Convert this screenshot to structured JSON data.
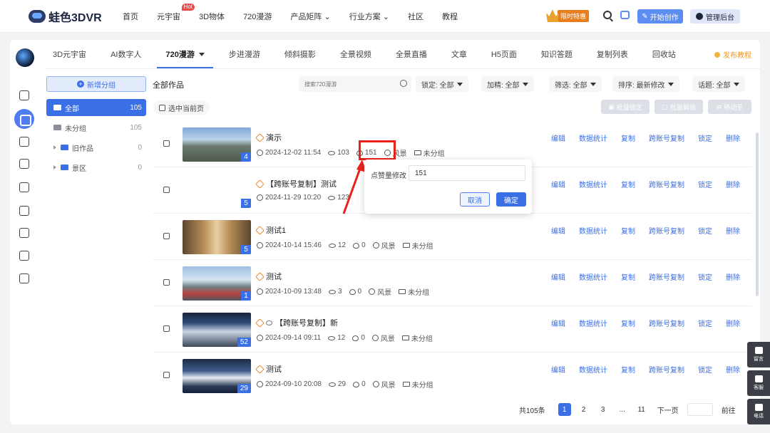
{
  "topnav": {
    "brand": "蛙色3DVR",
    "items": [
      "首页",
      "元宇宙",
      "3D物体",
      "720漫游",
      "产品矩阵",
      "行业方案",
      "社区",
      "教程"
    ],
    "hot_badge": "Hot",
    "promo": "限时特惠",
    "create_btn": "开始创作",
    "admin_btn": "管理后台"
  },
  "tabs": [
    "3D元宇宙",
    "AI数字人",
    "720漫游",
    "步进漫游",
    "倾斜摄影",
    "全景视频",
    "全景直播",
    "文章",
    "H5页面",
    "知识答题",
    "复制列表",
    "回收站"
  ],
  "publish_tutorial": "发布教程",
  "groups": {
    "add_btn": "新增分组",
    "items": [
      {
        "label": "全部",
        "count": "105"
      },
      {
        "label": "未分组",
        "count": "105"
      },
      {
        "label": "旧作品",
        "count": "0"
      },
      {
        "label": "景区",
        "count": "0"
      }
    ]
  },
  "content": {
    "heading": "全部作品",
    "search_placeholder": "搜索720漫游",
    "filters": {
      "lock": "锁定: 全部",
      "featured": "加精: 全部",
      "screen": "筛选: 全部",
      "sort": "排序: 最新修改",
      "topic": "话题: 全部"
    },
    "select_page": "选中当前页",
    "bulk": {
      "lock": "批量锁定",
      "unlock": "批量解锁",
      "move": "移动至"
    }
  },
  "actions": [
    "编辑",
    "数据统计",
    "复制",
    "跨账号复制",
    "锁定",
    "删除"
  ],
  "rows": [
    {
      "title": "演示",
      "date": "2024-12-02 11:54",
      "views": "103",
      "likes": "151",
      "tag": "风景",
      "group": "未分组",
      "scenes": "4"
    },
    {
      "title": "【跨账号复制】测试",
      "date": "2024-11-29 10:20",
      "views": "123",
      "likes": "",
      "tag": "",
      "group": "",
      "scenes": "5"
    },
    {
      "title": "测试1",
      "date": "2024-10-14 15:46",
      "views": "12",
      "likes": "0",
      "tag": "风景",
      "group": "未分组",
      "scenes": "5"
    },
    {
      "title": "测试",
      "date": "2024-10-09 13:48",
      "views": "3",
      "likes": "0",
      "tag": "风景",
      "group": "未分组",
      "scenes": "1"
    },
    {
      "title": "【跨账号复制】新",
      "date": "2024-09-14 09:11",
      "views": "12",
      "likes": "0",
      "tag": "风景",
      "group": "未分组",
      "scenes": "52"
    },
    {
      "title": "测试",
      "date": "2024-09-10 20:08",
      "views": "29",
      "likes": "0",
      "tag": "风景",
      "group": "未分组",
      "scenes": "29"
    }
  ],
  "popup": {
    "label": "点赞量修改",
    "value": "151",
    "cancel": "取消",
    "confirm": "确定"
  },
  "pager": {
    "total": "共105条",
    "pages": [
      "1",
      "2",
      "3",
      "...",
      "11"
    ],
    "next": "下一页",
    "goto": "前往"
  },
  "float": [
    "留言",
    "客服",
    "电话"
  ]
}
